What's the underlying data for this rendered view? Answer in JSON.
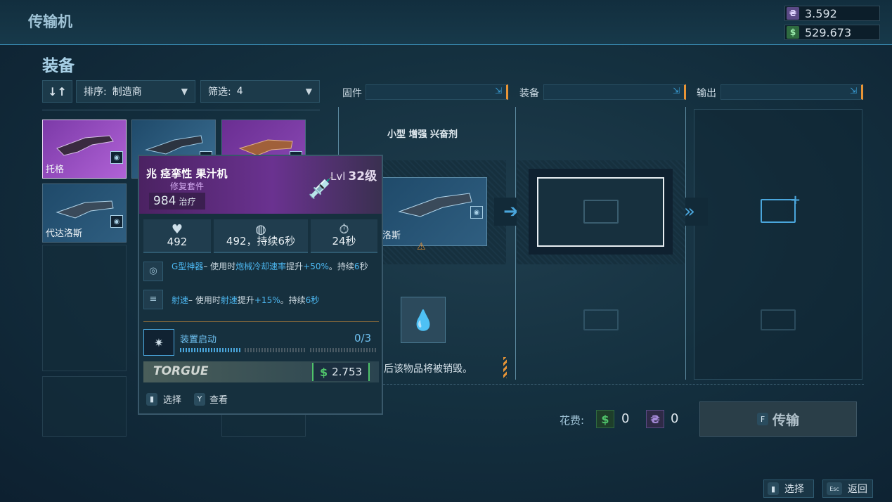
{
  "header": {
    "title": "传输机"
  },
  "currency": [
    {
      "icon": "eridium-icon",
      "symbol": "₴",
      "value": "3.592",
      "color": "#a58ad8"
    },
    {
      "icon": "cash-icon",
      "symbol": "$",
      "value": "529.673",
      "color": "#4fc36a"
    }
  ],
  "section": {
    "title": "装备"
  },
  "controls": {
    "sort_icon": "↓↑",
    "sort_label": "排序:",
    "sort_value": "制造商",
    "filter_label": "筛选:",
    "filter_value": "4"
  },
  "panels": {
    "firmware": "固件",
    "gear": "装备",
    "output": "输出",
    "expand_icon": "⇲"
  },
  "items": [
    {
      "name": "托格",
      "rarity": "purple"
    },
    {
      "name": "",
      "rarity": "blue"
    },
    {
      "name": "",
      "rarity": "purple"
    },
    {
      "name": "代达洛斯",
      "rarity": "blue"
    }
  ],
  "tooltip": {
    "name": "兆 痉挛性 果汁机",
    "level_label": "Lvl",
    "level_value": "32级",
    "type": "修复套件",
    "heal_value": "984",
    "heal_unit": "治疗",
    "stats": [
      {
        "icon": "health-icon",
        "value": "492"
      },
      {
        "icon": "timer-heal-icon",
        "value": "492，持续6秒"
      },
      {
        "icon": "cooldown-icon",
        "value": "24秒"
      }
    ],
    "perks": [
      {
        "icon": "grenade-icon",
        "name": "G型神器",
        "t1": "– 使用时",
        "h1": "炮械冷却速率",
        "t2": "提升",
        "h2": "+50%",
        "t3": "。持续",
        "h3": "6",
        "t4": "秒"
      },
      {
        "icon": "firerate-icon",
        "name": "射速",
        "t1": "– 使用时",
        "h1": "射速",
        "t2": "提升",
        "h2": "+15%",
        "t3": "。持续",
        "h3": "6秒"
      }
    ],
    "activation_label": "装置启动",
    "activation_count": "0/3",
    "manufacturer": "TORGUE",
    "price": "2.753",
    "hint_select_key": "🖱",
    "hint_select": "选择",
    "hint_view_key": "Y",
    "hint_view": "查看"
  },
  "firmware_panel": {
    "title": "小型 增强 兴奋剂",
    "item_name": "洛斯",
    "warning": "后该物品将被销毁。"
  },
  "cost": {
    "label": "花费:",
    "cash": "0",
    "eridium": "0"
  },
  "transfer": {
    "key": "F",
    "label": "传输"
  },
  "bottom": {
    "select": "选择",
    "back_key": "Esc",
    "back": "返回"
  }
}
